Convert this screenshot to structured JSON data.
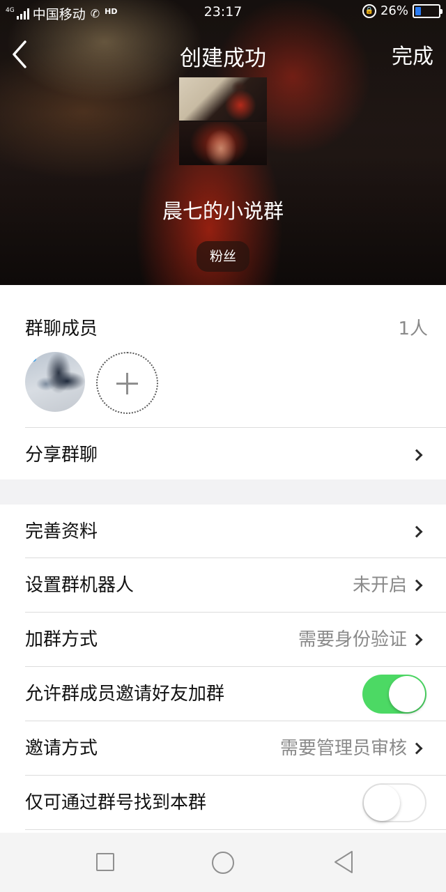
{
  "status_bar": {
    "network": "4G",
    "carrier": "中国移动",
    "hd": "HD",
    "time": "23:17",
    "battery": "26%",
    "battery_level": 0.26
  },
  "nav": {
    "title": "创建成功",
    "done_label": "完成"
  },
  "group": {
    "name": "晨七的小说群",
    "tag": "粉丝"
  },
  "members": {
    "title": "群聊成员",
    "count": "1人"
  },
  "share": {
    "label": "分享群聊"
  },
  "settings": [
    {
      "label": "完善资料",
      "value": ""
    },
    {
      "label": "设置群机器人",
      "value": "未开启"
    },
    {
      "label": "加群方式",
      "value": "需要身份验证"
    },
    {
      "label": "允许群成员邀请好友加群",
      "toggle": true
    },
    {
      "label": "邀请方式",
      "value": "需要管理员审核"
    },
    {
      "label": "仅可通过群号找到本群",
      "toggle": false
    }
  ],
  "colors": {
    "toggle_on": "#4cd964",
    "battery_fill": "#2a7cf4"
  }
}
